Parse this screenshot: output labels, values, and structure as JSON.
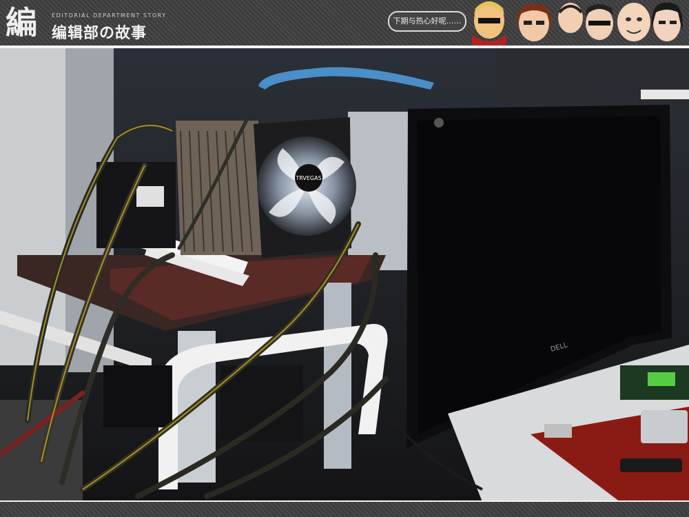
{
  "header": {
    "logo_char": "編",
    "subtitle": "EDITORIAL DEPARTMENT STORY",
    "title": "编辑部の故事",
    "speech": "下期与热心好呢……",
    "faces_icon": "cartoon-editor-faces"
  },
  "photo": {
    "fan_brand": "TRVEGAS",
    "monitor_brand": "DELL"
  }
}
